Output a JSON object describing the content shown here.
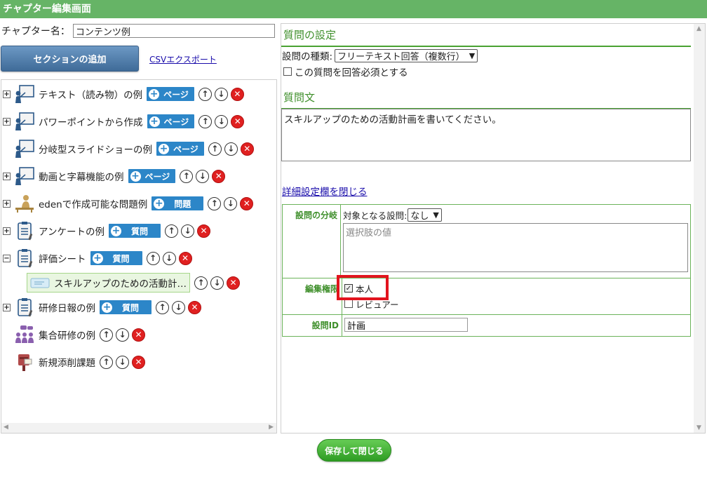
{
  "window": {
    "title": "チャプター編集画面"
  },
  "chapter": {
    "label": "チャプター名：",
    "value": "コンテンツ例"
  },
  "toolbar": {
    "add_section_label": "セクションの追加",
    "csv_export_label": "CSVエクスポート"
  },
  "tree": {
    "items": [
      {
        "label": "テキスト（読み物）の例",
        "add_label": "ページ",
        "expander": "+",
        "icon": "presentation-icon"
      },
      {
        "label": "パワーポイントから作成",
        "add_label": "ページ",
        "expander": "+",
        "icon": "presentation-icon"
      },
      {
        "label": "分岐型スライドショーの例",
        "add_label": "ページ",
        "expander": "",
        "icon": "presentation-icon"
      },
      {
        "label": "動画と字幕機能の例",
        "add_label": "ページ",
        "expander": "+",
        "icon": "presentation-icon"
      },
      {
        "label": "edenで作成可能な問題例",
        "add_label": "問題",
        "expander": "+",
        "icon": "study-desk-icon"
      },
      {
        "label": "アンケートの例",
        "add_label": "質問",
        "expander": "+",
        "icon": "clipboard-icon"
      },
      {
        "label": "評価シート",
        "add_label": "質問",
        "expander": "−",
        "icon": "clipboard-icon"
      },
      {
        "label": "研修日報の例",
        "add_label": "質問",
        "expander": "+",
        "icon": "clipboard-icon"
      },
      {
        "label": "集合研修の例",
        "expander": "",
        "icon": "group-meeting-icon"
      },
      {
        "label": "新規添削課題",
        "expander": "",
        "icon": "post-box-icon"
      }
    ],
    "selected_child": {
      "label": "スキルアップのための活動計…",
      "icon": "ticket-icon"
    }
  },
  "question_settings": {
    "heading": "質問の設定",
    "type_label": "設問の種類:",
    "type_value": "フリーテキスト回答（複数行）",
    "required_label": "この質問を回答必須とする",
    "required_checked": false
  },
  "question_text": {
    "heading": "質問文",
    "value": "スキルアップのための活動計画を書いてください。"
  },
  "detail": {
    "close_link": "詳細設定欄を閉じる",
    "branch": {
      "header": "設問の分岐",
      "target_label": "対象となる設問:",
      "target_value": "なし",
      "choice_placeholder": "選択肢の値"
    },
    "permission": {
      "header": "編集権限",
      "self_label": "本人",
      "self_checked": true,
      "reviewer_label": "レビュアー",
      "reviewer_checked": false
    },
    "question_id": {
      "header": "設問ID",
      "value": "計画"
    }
  },
  "footer": {
    "save_label": "保存して閉じる"
  },
  "colors": {
    "titlebar": "#66b466",
    "accent_green": "#3f8f2b",
    "add_button": "#2c86c8",
    "delete": "#e02020",
    "highlight": "#e2141e"
  }
}
